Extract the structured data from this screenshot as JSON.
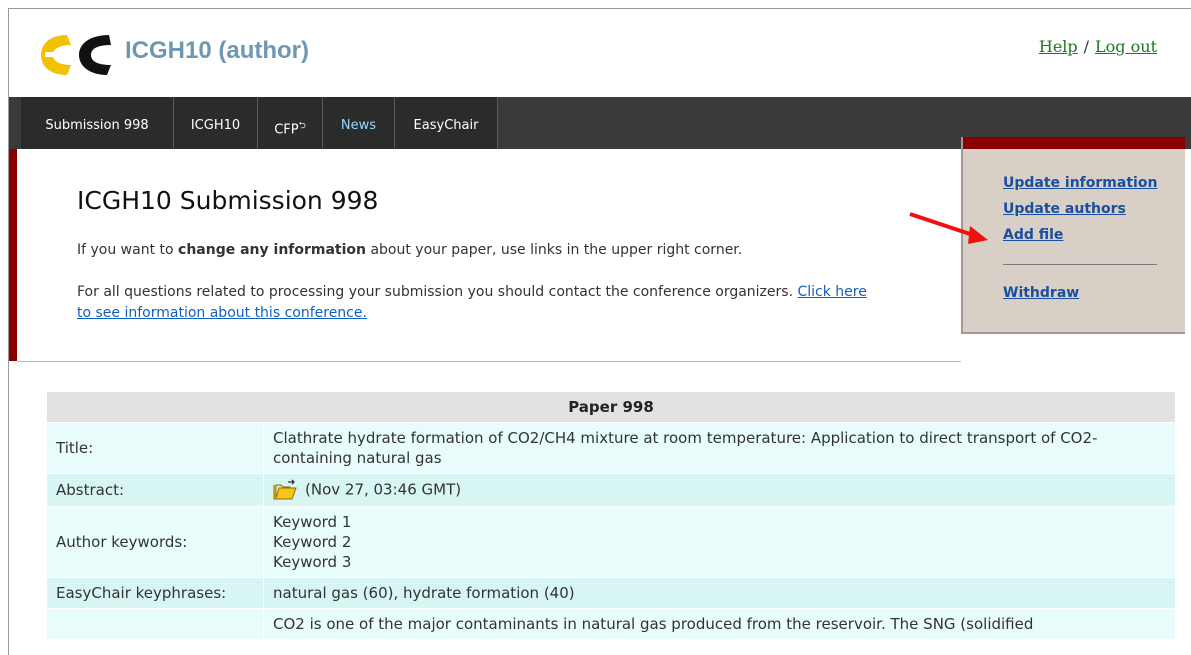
{
  "header": {
    "app_title": "ICGH10 (author)",
    "help_label": "Help",
    "separator": "/",
    "logout_label": "Log out"
  },
  "menu": {
    "items": [
      "Submission 998",
      "ICGH10",
      "CFP",
      "News",
      "EasyChair"
    ]
  },
  "main": {
    "title": "ICGH10 Submission 998",
    "para1_before": "If you want to ",
    "para1_bold": "change any information",
    "para1_after": " about your paper, use links in the upper right corner.",
    "para2_text": "For all questions related to processing your submission you should contact the conference organizers. ",
    "para2_link": "Click here to see information about this conference."
  },
  "side_panel": {
    "update_information": "Update information",
    "update_authors": "Update authors",
    "add_file": "Add file",
    "withdraw": "Withdraw"
  },
  "paper": {
    "caption": "Paper 998",
    "rows": [
      {
        "label": "Title:",
        "value": "Clathrate hydrate formation of CO2/CH4 mixture at room temperature: Application to direct transport of CO2-containing natural gas"
      },
      {
        "label": "Abstract:",
        "value": "(Nov 27, 03:46 GMT)"
      },
      {
        "label": "Author keywords:",
        "keywords": [
          "Keyword 1",
          "Keyword 2",
          "Keyword 3"
        ]
      },
      {
        "label": "EasyChair keyphrases:",
        "value": "natural gas (60), hydrate formation (40)"
      },
      {
        "label": "",
        "value": "CO2 is one of the major contaminants in natural gas produced from the reservoir. The SNG (solidified"
      }
    ]
  },
  "colors": {
    "menubar": "#3a3a3a",
    "accent_red": "#8b0000",
    "title_blue": "#6e98b1",
    "link_green": "#1a7a1a"
  }
}
